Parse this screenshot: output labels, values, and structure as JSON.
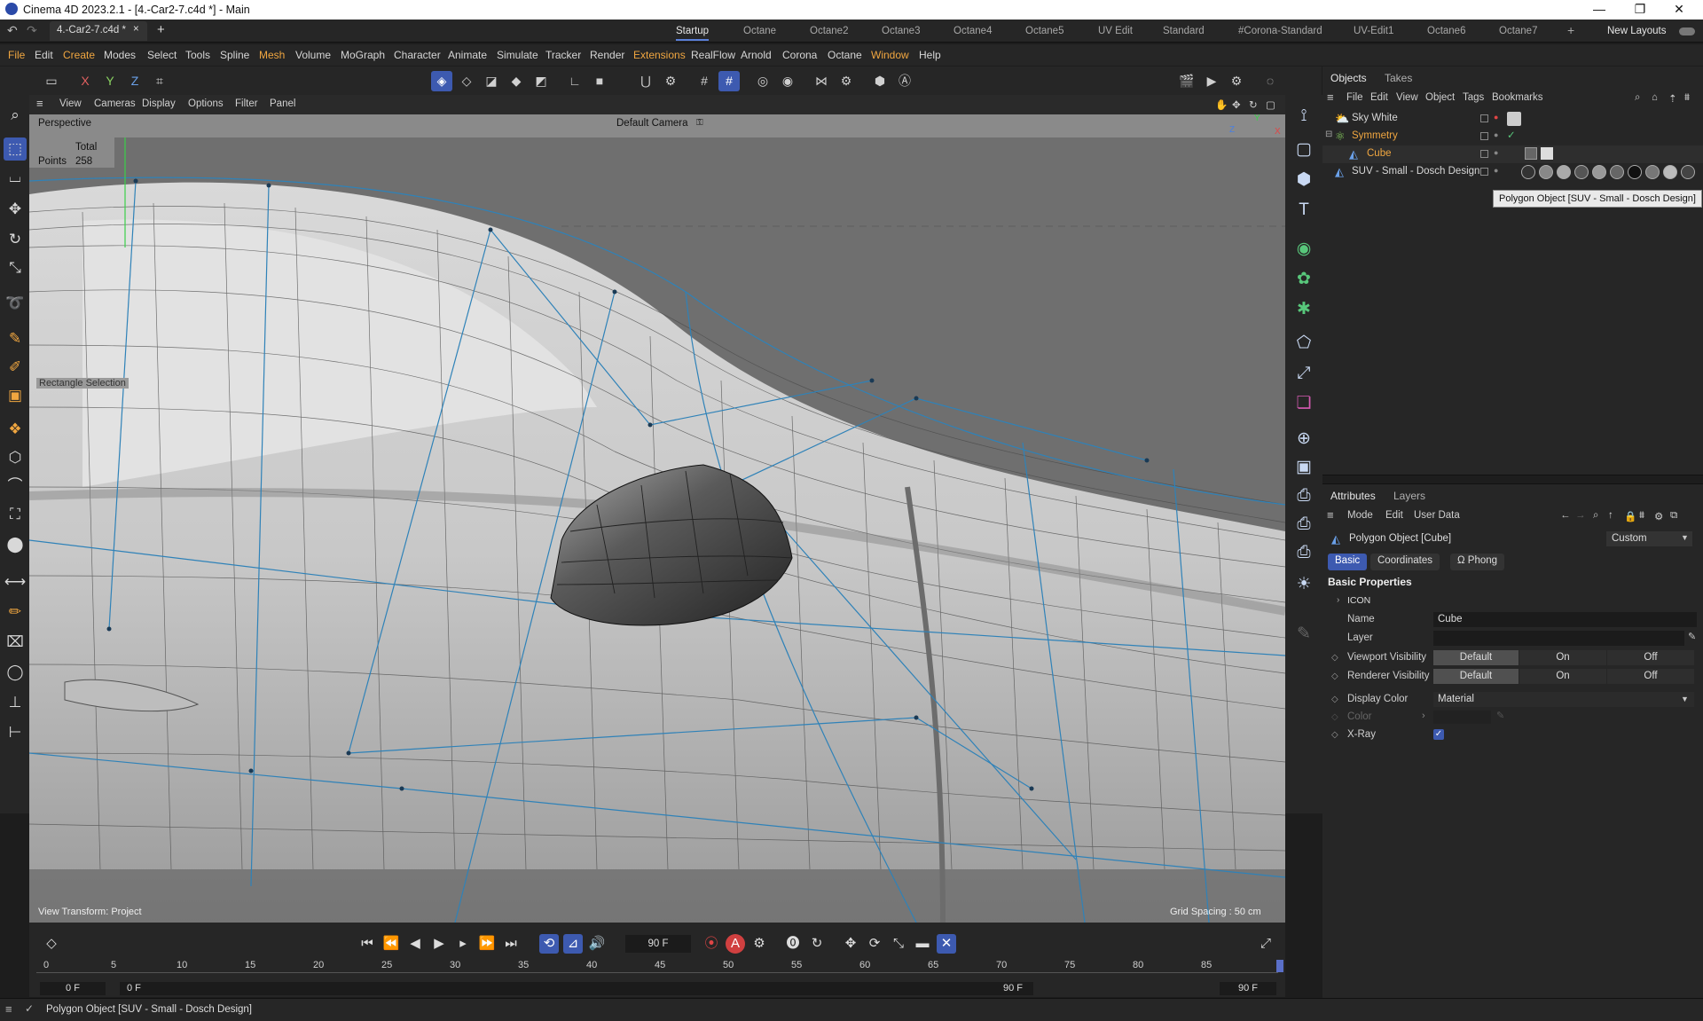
{
  "window": {
    "title": "Cinema 4D 2023.2.1 - [4.-Car2-7.c4d *] - Main",
    "minimize": "—",
    "maximize": "❐",
    "close": "✕"
  },
  "doc_tab": {
    "label": "4.-Car2-7.c4d *",
    "close": "×",
    "add": "+"
  },
  "layouts": [
    "Startup",
    "Octane",
    "Octane2",
    "Octane3",
    "Octane4",
    "Octane5",
    "UV Edit",
    "Standard",
    "#Corona-Standard",
    "UV-Edit1",
    "Octane6",
    "Octane7"
  ],
  "layout_add": "+",
  "new_layouts": "New Layouts",
  "menus": [
    "File",
    "Edit",
    "Create",
    "Modes",
    "Select",
    "Tools",
    "Spline",
    "Mesh",
    "Volume",
    "MoGraph",
    "Character",
    "Animate",
    "Simulate",
    "Tracker",
    "Render",
    "Extensions",
    "RealFlow",
    "Arnold",
    "Corona",
    "Octane",
    "Window",
    "Help"
  ],
  "axis_buttons": {
    "x": "X",
    "y": "Y",
    "z": "Z"
  },
  "viewport_menu": [
    "View",
    "Cameras",
    "Display",
    "Options",
    "Filter",
    "Panel"
  ],
  "viewport": {
    "projection": "Perspective",
    "camera": "Default Camera",
    "stats_header": "Total",
    "stats_label": "Points",
    "stats_value": "258",
    "hud_tool": "Rectangle Selection",
    "view_transform": "View Transform: Project",
    "grid_spacing": "Grid Spacing : 50 cm",
    "axis_x": "X",
    "axis_y": "Y",
    "axis_z": "Z"
  },
  "objects_panel": {
    "tabs": [
      "Objects",
      "Takes"
    ],
    "menu": [
      "File",
      "Edit",
      "View",
      "Object",
      "Tags",
      "Bookmarks"
    ],
    "items": [
      {
        "name": "Sky White"
      },
      {
        "name": "Symmetry"
      },
      {
        "name": "Cube"
      },
      {
        "name": "SUV - Small - Dosch Design"
      }
    ],
    "tooltip": "Polygon Object [SUV - Small - Dosch Design]"
  },
  "attributes": {
    "tabs": [
      "Attributes",
      "Layers"
    ],
    "menu": [
      "Mode",
      "Edit",
      "User Data"
    ],
    "object_title": "Polygon Object [Cube]",
    "preset": "Custom",
    "subtabs": [
      "Basic",
      "Coordinates",
      "Phong"
    ],
    "section": "Basic Properties",
    "group": "ICON",
    "name_label": "Name",
    "name_value": "Cube",
    "layer_label": "Layer",
    "viewport_vis_label": "Viewport Visibility",
    "renderer_vis_label": "Renderer Visibility",
    "vis_options": [
      "Default",
      "On",
      "Off"
    ],
    "display_color_label": "Display Color",
    "display_color_value": "Material",
    "color_label": "Color",
    "xray_label": "X-Ray",
    "xray_checked": true
  },
  "timeline": {
    "current_frame": "90 F",
    "ticks": [
      "0",
      "5",
      "10",
      "15",
      "20",
      "25",
      "30",
      "35",
      "40",
      "45",
      "50",
      "55",
      "60",
      "65",
      "70",
      "75",
      "80",
      "85"
    ],
    "start_a": "0 F",
    "start_b": "0 F",
    "end_a": "90 F",
    "end_b": "90 F"
  },
  "status": {
    "text": "Polygon Object [SUV - Small - Dosch Design]"
  },
  "colors": {
    "accent": "#3d5ab0",
    "highlight": "#f0a640",
    "wire_blue": "#2f82b8"
  }
}
